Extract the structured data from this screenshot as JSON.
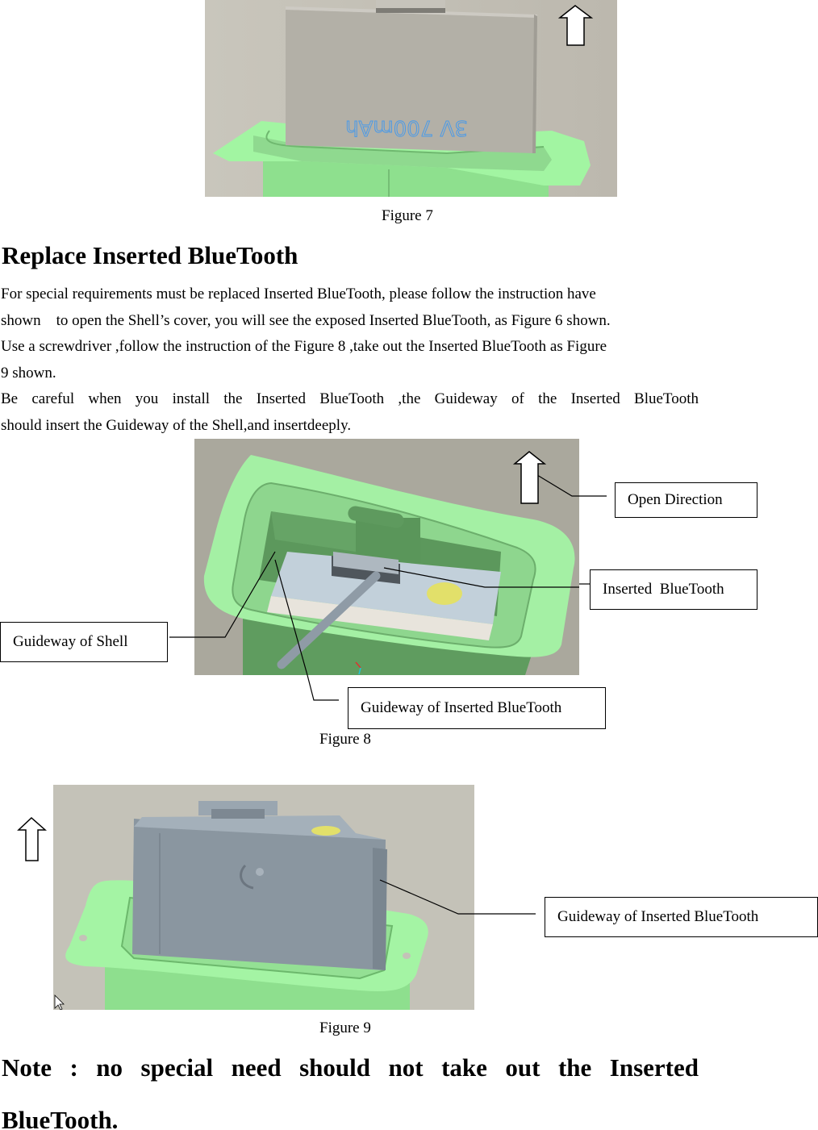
{
  "figure7": {
    "caption": "Figure 7",
    "battery_label": "3V 700mAh",
    "icon": "up-arrow-icon",
    "colors": {
      "background": "#bdb9ae",
      "shell": "#9ef29e",
      "battery": "#b4b1a9",
      "label_text": "#4a9ae8"
    }
  },
  "section": {
    "heading": "Replace Inserted BlueTooth",
    "lines": [
      "For special requirements must be replaced Inserted BlueTooth, please follow the instruction have",
      "shown    to open the Shell’s cover, you will see the exposed Inserted BlueTooth, as Figure 6 shown.",
      "Use a screwdriver ,follow the instruction of the Figure 8 ,take out the Inserted BlueTooth as Figure",
      "9 shown.",
      "Be careful when you install the Inserted BlueTooth ,the Guideway of the Inserted BlueTooth",
      "should insert the Guideway of the Shell,and insertdeeply."
    ]
  },
  "figure8": {
    "caption": "Figure 8",
    "icon": "up-arrow-icon",
    "callouts": {
      "open_direction": "Open Direction",
      "inserted_bluetooth": "Inserted  BlueTooth",
      "guideway_shell": "Guideway of Shell",
      "guideway_bluetooth": "Guideway of Inserted BlueTooth"
    },
    "colors": {
      "background": "#aaa89d",
      "shell": "#a4f0a4",
      "shell_dark": "#5e9a5e",
      "module": "#c2d0da",
      "contact": "#e2e06a"
    }
  },
  "figure9": {
    "caption": "Figure 9",
    "icon": "up-arrow-icon",
    "callouts": {
      "guideway_bluetooth": "Guideway of Inserted BlueTooth"
    },
    "colors": {
      "background": "#c4c2b8",
      "shell": "#a4f0a4",
      "module": "#8a96a0",
      "contact": "#e2e06a"
    }
  },
  "note": {
    "line1": "Note  :  no  special  need  should  not  take  out  the  Inserted",
    "line2": "BlueTooth."
  }
}
